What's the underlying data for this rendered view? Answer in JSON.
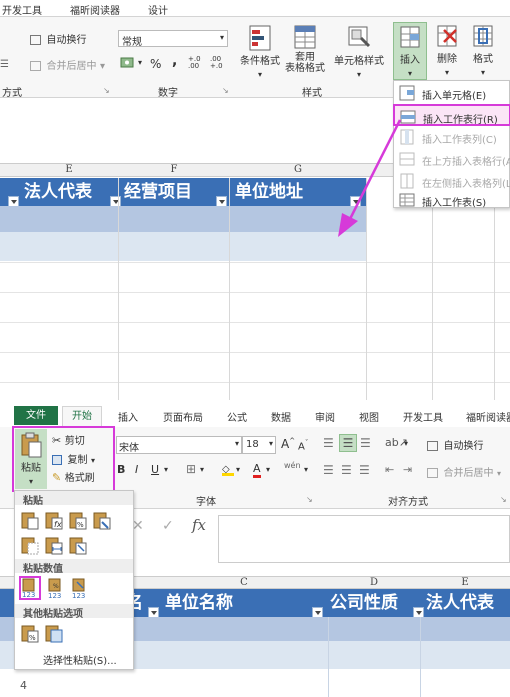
{
  "top_ribbon": {
    "tabs": [
      "开发工具",
      "福昕阅读器",
      "设计"
    ],
    "wrap_text": "自动换行",
    "merge_center": "合并后居中",
    "number_format": "常规",
    "percent": "%",
    "comma": ",",
    "decimal_inc": "+.0 .00",
    "decimal_dec": ".00 +.0",
    "group_alignment": "方式",
    "group_number": "数字",
    "group_styles": "样式",
    "cond_format": "条件格式",
    "table_format_1": "套用",
    "table_format_2": "表格格式",
    "cell_styles": "单元格样式",
    "insert": "插入",
    "delete": "删除",
    "format": "格式"
  },
  "insert_menu": {
    "items": [
      {
        "label": "插入单元格(E)",
        "enabled": true
      },
      {
        "label": "插入工作表行(R)",
        "enabled": true
      },
      {
        "label": "插入工作表列(C)",
        "enabled": false
      },
      {
        "label": "在上方插入表格行(A)",
        "enabled": false
      },
      {
        "label": "在左侧插入表格列(L)",
        "enabled": false
      },
      {
        "label": "插入工作表(S)",
        "enabled": true
      }
    ]
  },
  "top_sheet": {
    "columns": [
      "E",
      "F",
      "G"
    ],
    "headers": [
      "法人代表",
      "经营项目",
      "单位地址"
    ]
  },
  "bottom_ribbon": {
    "tabs": [
      "文件",
      "开始",
      "插入",
      "页面布局",
      "公式",
      "数据",
      "审阅",
      "视图",
      "开发工具",
      "福昕阅读器"
    ],
    "paste": "粘贴",
    "cut": "剪切",
    "copy": "复制",
    "format_painter": "格式刷",
    "font_name": "宋体",
    "font_size": "18",
    "wen": "wén",
    "wrap_text": "自动换行",
    "merge_center": "合并后居中",
    "group_font": "字体",
    "group_alignment": "对齐方式",
    "fx": "fx"
  },
  "paste_menu": {
    "section_paste": "粘贴",
    "section_values": "粘贴数值",
    "section_other": "其他粘贴选项",
    "special": "选择性粘贴(S)..."
  },
  "bottom_sheet": {
    "columns": [
      "C",
      "D",
      "E"
    ],
    "headers": [
      "名",
      "单位名称",
      "公司性质",
      "法人代表"
    ],
    "row_number": "4"
  },
  "colors": {
    "header_blue": "#3a6fb5",
    "highlight_magenta": "#d63ad9",
    "excel_green": "#217346",
    "selection_blue": "#dce6f1"
  }
}
